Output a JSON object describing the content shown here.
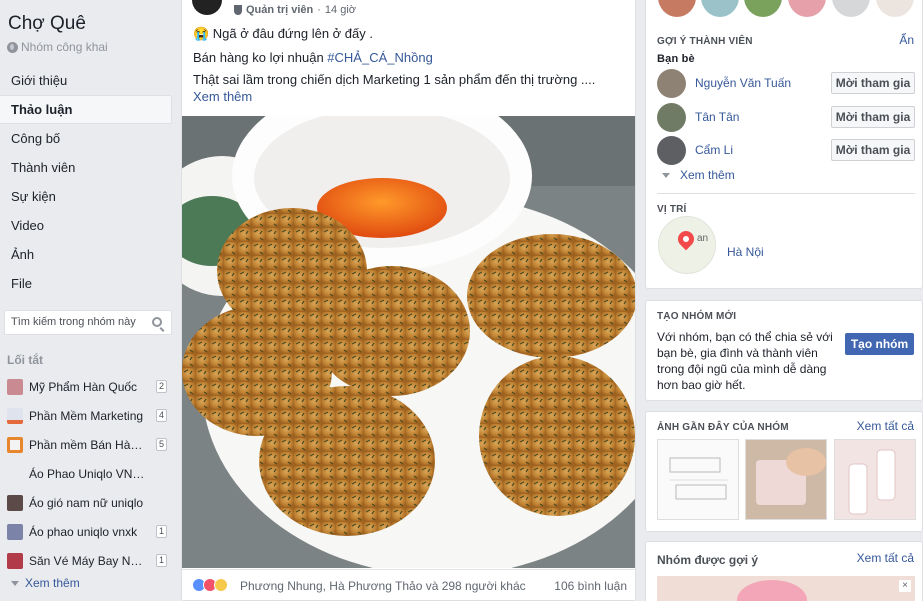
{
  "group": {
    "name": "Chợ Quê",
    "privacy": "Nhóm công khai"
  },
  "nav": [
    {
      "label": "Giới thiệu",
      "active": false
    },
    {
      "label": "Thảo luận",
      "active": true
    },
    {
      "label": "Công bố",
      "active": false
    },
    {
      "label": "Thành viên",
      "active": false
    },
    {
      "label": "Sự kiện",
      "active": false
    },
    {
      "label": "Video",
      "active": false
    },
    {
      "label": "Ảnh",
      "active": false
    },
    {
      "label": "File",
      "active": false
    }
  ],
  "search": {
    "placeholder": "Tìm kiếm trong nhóm này"
  },
  "shortcuts": {
    "title": "Lối tắt",
    "items": [
      {
        "label": "Mỹ Phẩm Hàn Quốc",
        "badge": "2"
      },
      {
        "label": "Phần Mềm Marketing",
        "badge": "4"
      },
      {
        "label": "Phần mềm Bán Hàn...",
        "badge": "5"
      },
      {
        "label": "Áo Phao Uniqlo VNXK",
        "badge": ""
      },
      {
        "label": "Áo gió nam nữ uniqlo",
        "badge": ""
      },
      {
        "label": "Áo phao uniqlo vnxk",
        "badge": "1"
      },
      {
        "label": "Săn Vé Máy Bay Nội ...",
        "badge": "1"
      }
    ],
    "see_more": "Xem thêm"
  },
  "post": {
    "role": "Quản trị viên",
    "time": "14 giờ",
    "line1": "😭 Ngã ở đâu đứng lên ở đấy .",
    "line2_prefix": "Bán hàng ko lợi nhuận ",
    "hashtag": "#CHẢ_CÁ_Nhồng",
    "line3": "Thật sai lầm trong chiến dịch Marketing 1 sản phẩm đến thị trường ....",
    "see_more": "Xem thêm",
    "reactions_text": "Phương Nhung, Hà Phương Thảo và 298 người khác",
    "comments": "106 bình luận"
  },
  "suggest_members": {
    "title": "GỢI Ý THÀNH VIÊN",
    "hide": "Ẩn",
    "subtitle": "Bạn bè",
    "friends": [
      {
        "name": "Nguyễn Văn Tuấn",
        "button": "Mời tham gia"
      },
      {
        "name": "Tân Tân",
        "button": "Mời tham gia"
      },
      {
        "name": "Cẩm Li",
        "button": "Mời tham gia"
      }
    ],
    "see_more": "Xem thêm"
  },
  "location": {
    "title": "VỊ TRÍ",
    "city": "Hà Nội",
    "map_label": "an"
  },
  "create_group": {
    "title": "TẠO NHÓM MỚI",
    "desc": "Với nhóm, bạn có thể chia sẻ với bạn bè, gia đình và thành viên trong đội ngũ của mình dễ dàng hơn bao giờ hết.",
    "button": "Tạo nhóm"
  },
  "recent_photos": {
    "title": "ẢNH GẦN ĐÂY CỦA NHÓM",
    "see_all": "Xem tất cả"
  },
  "suggested_groups": {
    "title": "Nhóm được gợi ý",
    "see_all": "Xem tất cả"
  },
  "colors": {
    "link": "#365899",
    "primary": "#4267b2",
    "background": "#e9ebee"
  }
}
